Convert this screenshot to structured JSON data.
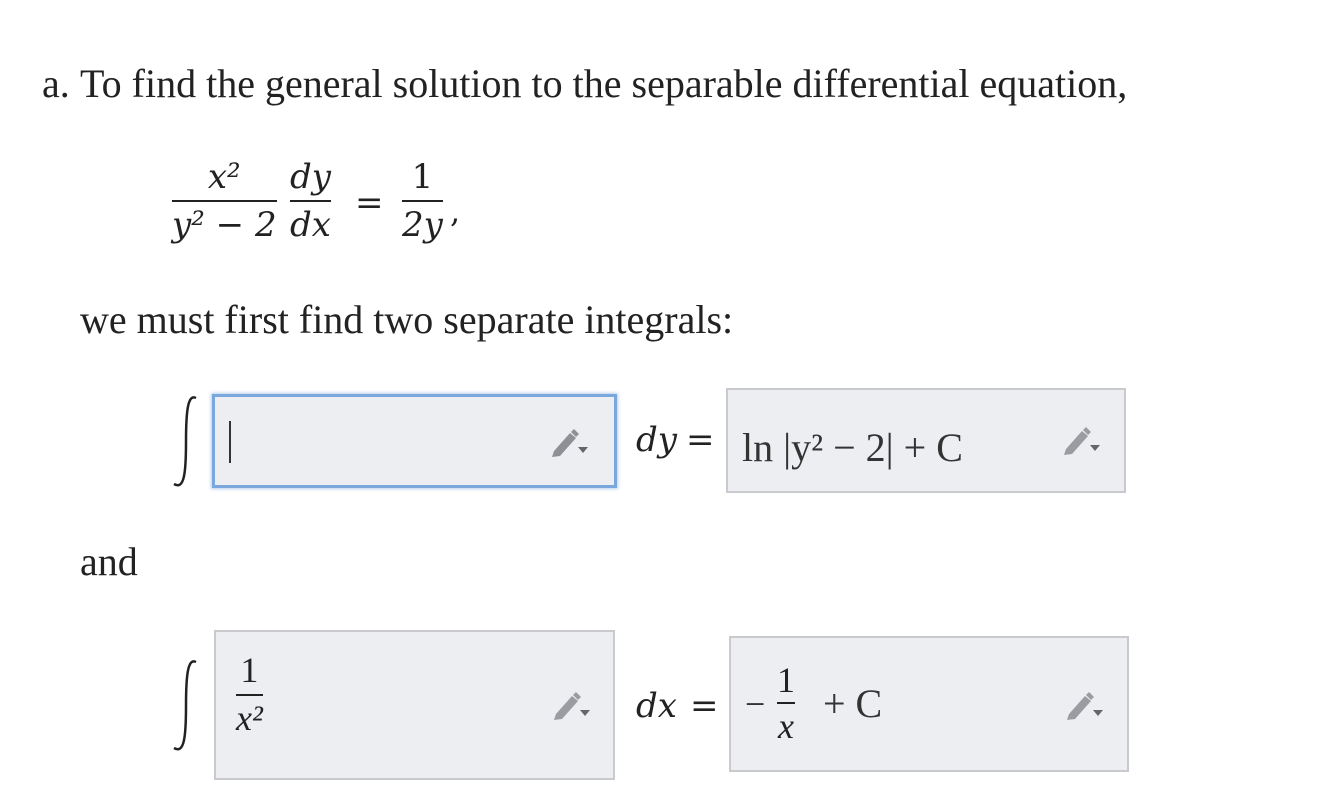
{
  "prompt": {
    "part_label": "a.",
    "intro_text": "To find the general solution to the separable differential equation,",
    "after_equation": "we must first find two separate integrals:",
    "connector": "and"
  },
  "equation": {
    "lhs_num": "x²",
    "lhs_den": "y² − 2",
    "deriv_num": "dy",
    "deriv_den": "dx",
    "equals": "=",
    "rhs_num": "1",
    "rhs_den": "2y",
    "trailing": ","
  },
  "integral_1": {
    "integrand_value": "",
    "differential": "dy",
    "equals": "=",
    "result_text": "ln |y² − 2| + C"
  },
  "integral_2": {
    "integrand_num": "1",
    "integrand_den": "x²",
    "differential": "dx",
    "equals": "=",
    "result_sign": "−",
    "result_num": "1",
    "result_den": "x",
    "result_tail": "+ C"
  },
  "icons": {
    "edit": "pencil-icon",
    "dropdown": "caret-down-icon"
  },
  "colors": {
    "box_fill": "#eceef1",
    "box_border": "#c8cace",
    "active_border": "#7aa7dc",
    "text": "#222222"
  }
}
